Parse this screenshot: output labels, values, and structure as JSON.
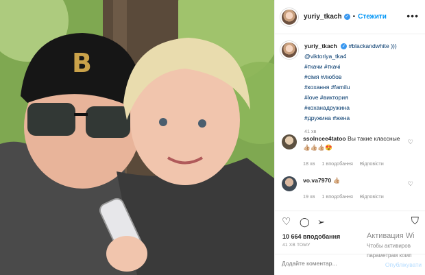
{
  "post": {
    "photo_alt": "selfie of a man in a black cap and a blonde woman"
  },
  "header": {
    "username": "yuriy_tkach",
    "verified_glyph": "✓",
    "separator": "•",
    "follow_label": "Стежити",
    "more_glyph": "•••"
  },
  "caption": {
    "username": "yuriy_tkach",
    "first_line": "#blackandwhite )))",
    "mention": "@viktoriya_tka4",
    "tags": [
      "#ткачи #ткачі",
      "#сімя #любов",
      "#кохання #familu",
      "#love #виктория",
      "#коханадружина",
      "#дружина #жена"
    ],
    "time": "41 хв"
  },
  "comments": [
    {
      "username": "ssolncee4tatoo",
      "text": "Вы такие классные 👍🏼👍🏼👍🏼😍",
      "time": "18 хв",
      "likes": "1 вподобання",
      "reply": "Відповісти",
      "heart_glyph": "♡"
    },
    {
      "username": "vo.va7970",
      "text": "👍🏼",
      "time": "19 хв",
      "likes": "1 вподобання",
      "reply": "Відповісти",
      "heart_glyph": "♡"
    }
  ],
  "actions": {
    "like_glyph": "♡",
    "comment_glyph": "◯",
    "share_glyph": "➢",
    "save_glyph": "⛉",
    "likes_count": "10 664 вподобання",
    "posted_ago": "41 ХВ ТОМУ"
  },
  "add_comment": {
    "placeholder": "Додайте коментар...",
    "publish_label": "Опублікувати"
  },
  "watermark": {
    "title": "Активация Wi",
    "line1": "Чтобы активиров",
    "line2": "параметрам комп"
  },
  "colors": {
    "accent": "#0095f6",
    "verified": "#3897f0",
    "muted": "#8e8e8e",
    "tag": "#00376b"
  }
}
